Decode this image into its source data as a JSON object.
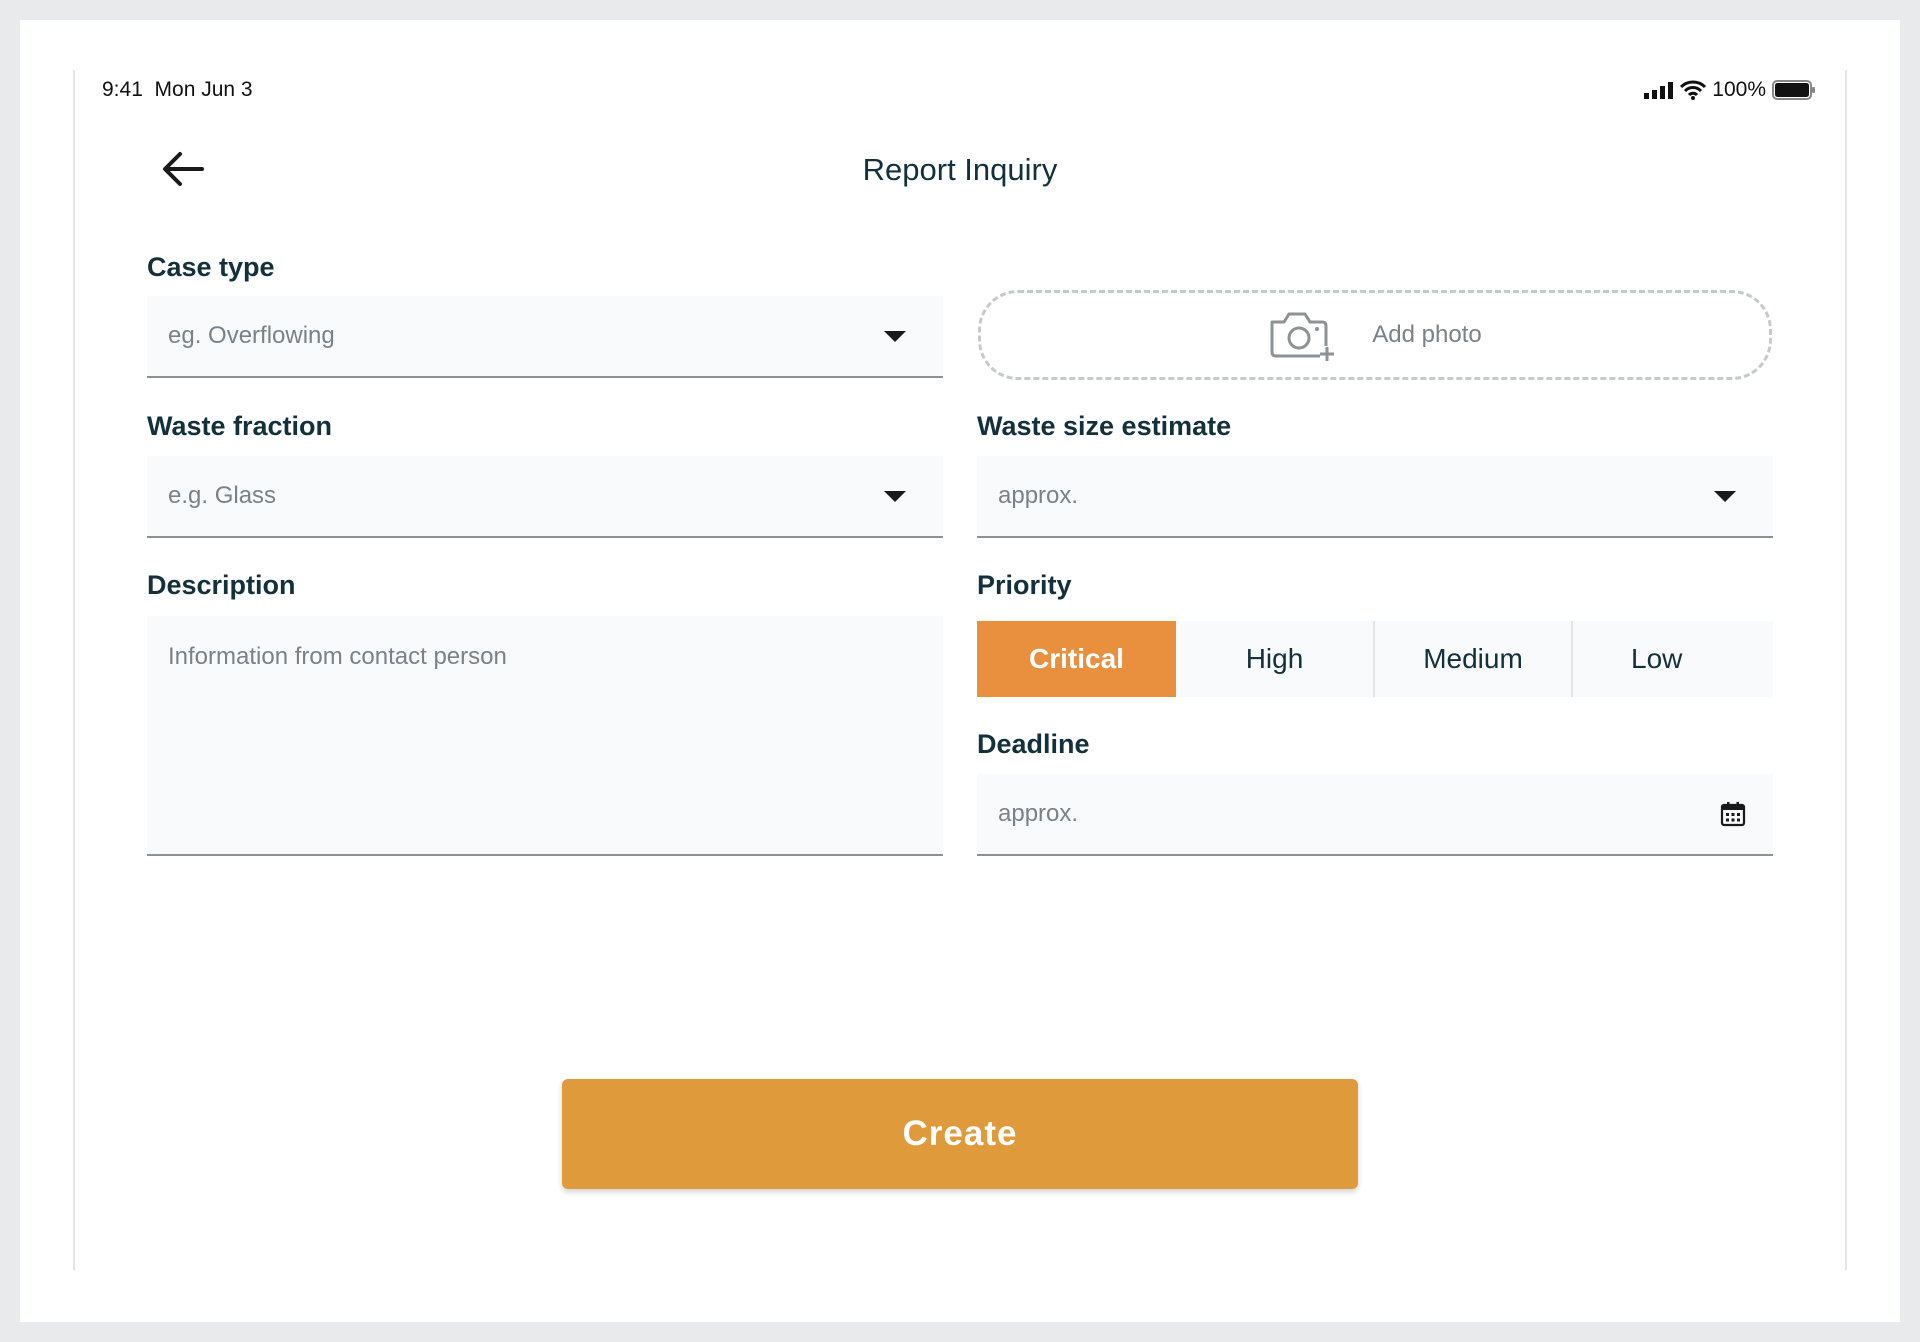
{
  "status_bar": {
    "time": "9:41",
    "date": "Mon Jun 3",
    "battery": "100%"
  },
  "header": {
    "title": "Report Inquiry",
    "back_icon": "arrow-left-icon"
  },
  "form": {
    "case_type": {
      "label": "Case type",
      "placeholder": "eg. Overflowing"
    },
    "add_photo": {
      "label": "Add photo",
      "icon": "camera-plus-icon"
    },
    "waste_fraction": {
      "label": "Waste fraction",
      "placeholder": "e.g. Glass"
    },
    "waste_size": {
      "label": "Waste size estimate",
      "placeholder": "approx."
    },
    "description": {
      "label": "Description",
      "placeholder": "Information from contact person"
    },
    "priority": {
      "label": "Priority",
      "options": [
        "Critical",
        "High",
        "Medium",
        "Low"
      ],
      "selected": "Critical"
    },
    "deadline": {
      "label": "Deadline",
      "placeholder": "approx.",
      "icon": "calendar-icon"
    }
  },
  "actions": {
    "create_label": "Create"
  },
  "colors": {
    "accent": "#df9a3b",
    "priority_active": "#e8903e",
    "text_dark": "#14303b",
    "placeholder": "#7a8287",
    "field_bg": "#f9fafb"
  }
}
